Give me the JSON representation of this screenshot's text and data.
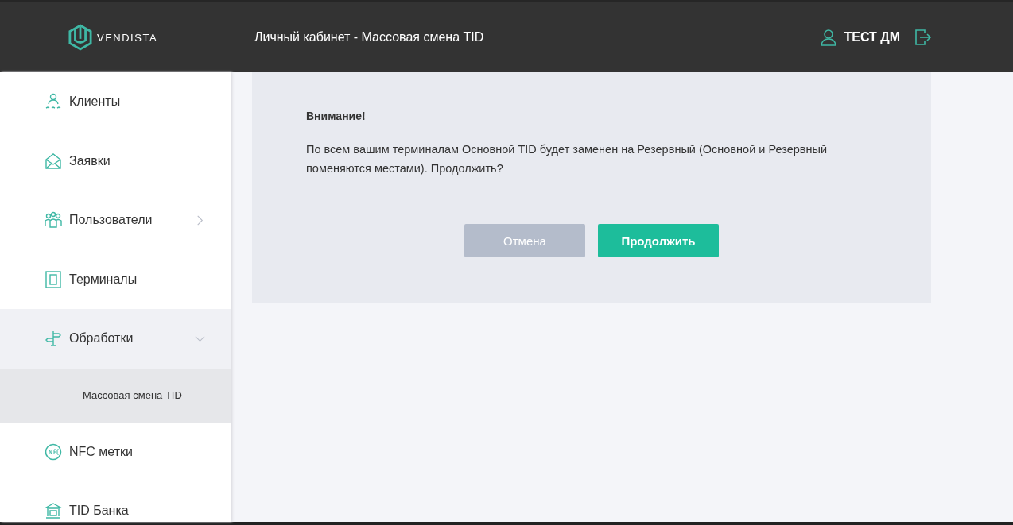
{
  "header": {
    "logo": "VENDISTA",
    "title": "Личный кабинет - Массовая смена TID",
    "user": "ТЕСТ ДМ"
  },
  "sidebar": {
    "items": [
      {
        "label": "Клиенты",
        "kind": "link"
      },
      {
        "label": "Заявки",
        "kind": "link"
      },
      {
        "label": "Пользователи",
        "kind": "group",
        "expanded": false
      },
      {
        "label": "Терминалы",
        "kind": "link"
      },
      {
        "label": "Обработки",
        "kind": "group",
        "expanded": true,
        "children": [
          {
            "label": "Массовая смена TID",
            "selected": true
          }
        ]
      },
      {
        "label": "NFC метки",
        "kind": "link"
      },
      {
        "label": "TID Банка",
        "kind": "link"
      }
    ]
  },
  "dialog": {
    "title": "Внимание!",
    "message": "По всем вашим терминалам Основной TID будет заменен на Резервный (Основной и Резервный поменяются местами). Продолжить?",
    "buttons": [
      {
        "label": "Отмена",
        "kind": "secondary"
      },
      {
        "label": "Продолжить",
        "kind": "primary"
      }
    ]
  }
}
